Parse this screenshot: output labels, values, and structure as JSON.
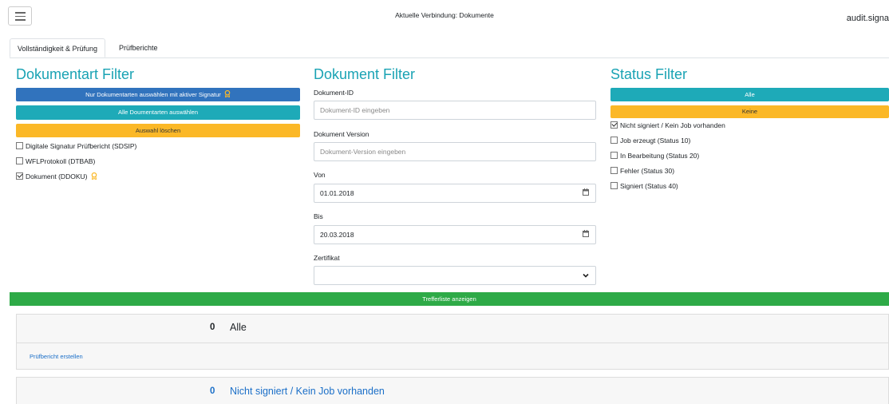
{
  "header": {
    "connection": "Aktuelle Verbindung: Dokumente",
    "user": "audit.signa"
  },
  "tabs": [
    {
      "label": "Vollständigkeit & Prüfung",
      "active": true
    },
    {
      "label": "Prüfberichte",
      "active": false
    }
  ],
  "doc_type_filter": {
    "title": "Dokumentart Filter",
    "btn_signature": "Nur Dokumentarten auswählen mit aktiver Signatur",
    "btn_all": "Alle Doumentarten auswählen",
    "btn_clear": "Auswahl löschen",
    "items": [
      {
        "label": "Digitale Signatur Prüfbericht (SDSIP)",
        "checked": false,
        "seal": false
      },
      {
        "label": "WFLProtokoll (DTBAB)",
        "checked": false,
        "seal": false
      },
      {
        "label": "Dokument (DDOKU)",
        "checked": true,
        "seal": true
      }
    ]
  },
  "doc_filter": {
    "title": "Dokument Filter",
    "id_label": "Dokument-ID",
    "id_placeholder": "Dokument-ID eingeben",
    "version_label": "Dokument Version",
    "version_placeholder": "Dokument-Version eingeben",
    "from_label": "Von",
    "from_value": "01.01.2018",
    "to_label": "Bis",
    "to_value": "20.03.2018",
    "cert_label": "Zertifikat",
    "cert_value": ""
  },
  "status_filter": {
    "title": "Status Filter",
    "btn_all": "Alle",
    "btn_none": "Keine",
    "items": [
      {
        "label": "Nicht signiert / Kein Job vorhanden",
        "checked": true
      },
      {
        "label": "Job erzeugt (Status 10)",
        "checked": false
      },
      {
        "label": "In Bearbeitung (Status 20)",
        "checked": false
      },
      {
        "label": "Fehler (Status 30)",
        "checked": false
      },
      {
        "label": "Signiert (Status 40)",
        "checked": false
      }
    ]
  },
  "results_button": "Trefferliste anzeigen",
  "results": [
    {
      "count": "0",
      "label": "Alle",
      "link": "Prüfbericht erstellen"
    },
    {
      "count": "0",
      "label": "Nicht signiert / Kein Job vorhanden"
    }
  ],
  "colors": {
    "accent": "#1aa3b4",
    "primary": "#3173bd",
    "warning": "#fbb827",
    "success": "#2eaa47",
    "link": "#1b6fc8"
  }
}
